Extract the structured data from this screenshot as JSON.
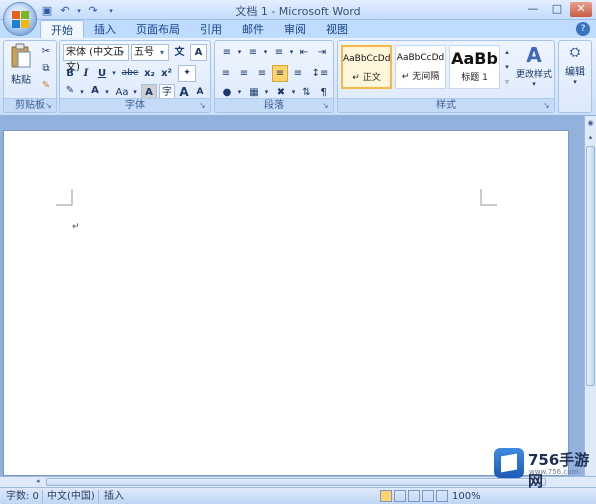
{
  "window": {
    "title": "文档 1 - Microsoft Word"
  },
  "qat": {
    "save_icon": "save-icon",
    "undo_icon": "undo-icon",
    "redo_icon": "redo-icon"
  },
  "tabs": [
    {
      "label": "开始"
    },
    {
      "label": "插入"
    },
    {
      "label": "页面布局"
    },
    {
      "label": "引用"
    },
    {
      "label": "邮件"
    },
    {
      "label": "审阅"
    },
    {
      "label": "视图"
    }
  ],
  "ribbon": {
    "clipboard": {
      "label": "剪贴板",
      "paste_label": "粘贴"
    },
    "font": {
      "label": "字体",
      "font_name": "宋体 (中文正文)",
      "font_size": "五号",
      "bold": "B",
      "italic": "I",
      "underline": "U",
      "strike": "abe",
      "subscript": "x₂",
      "superscript": "x²",
      "grow": "A",
      "shrink": "A",
      "change_case": "Aa"
    },
    "paragraph": {
      "label": "段落"
    },
    "styles": {
      "label": "样式",
      "items": [
        {
          "sample": "AaBbCcDd",
          "name": "↵ 正文"
        },
        {
          "sample": "AaBbCcDd",
          "name": "↵ 无间隔"
        },
        {
          "sample": "AaBb",
          "name": "标题 1"
        }
      ],
      "change_styles_label": "更改样式"
    },
    "editing": {
      "label": "编辑"
    }
  },
  "document": {
    "paragraph_mark": "↵"
  },
  "statusbar": {
    "word_count": "字数: 0",
    "language": "中文(中国)",
    "insert_mode": "插入",
    "zoom": "100%"
  },
  "watermark": {
    "text": "756手游网",
    "sub": "www.756.com"
  },
  "colors": {
    "accent": "#15428b",
    "ribbon_bg": "#d7e7fc",
    "page": "#ffffff"
  }
}
